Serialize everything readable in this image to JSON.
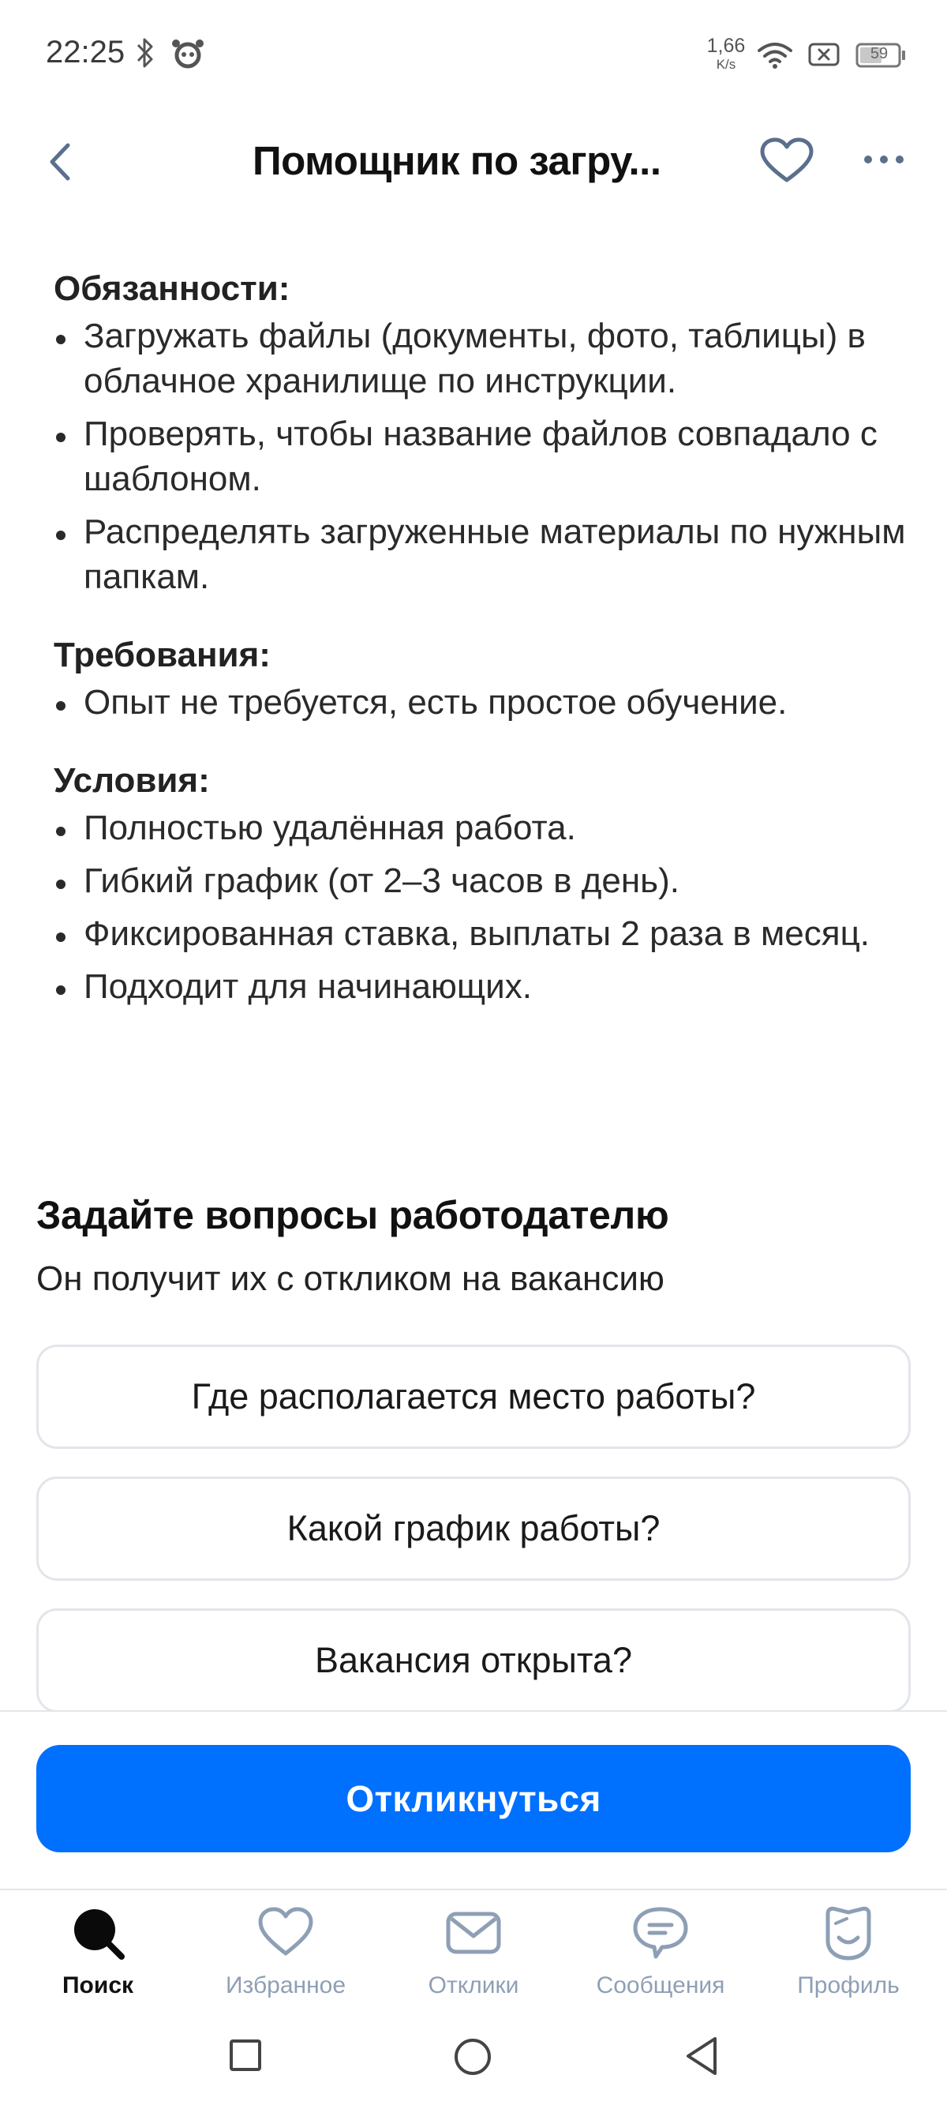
{
  "status_bar": {
    "time": "22:25",
    "net_speed_value": "1,66",
    "net_speed_unit": "K/s",
    "battery": "59"
  },
  "header": {
    "title": "Помощник по загру..."
  },
  "description": {
    "duties_title": "Обязанности:",
    "duties": [
      "Загружать файлы (документы, фото, таблицы) в облачное хранилище по инструкции.",
      "Проверять, чтобы название файлов совпадало с шаблоном.",
      "Распределять загруженные материалы по нужным папкам."
    ],
    "requirements_title": "Требования:",
    "requirements": [
      "Опыт не требуется, есть простое обучение."
    ],
    "conditions_title": "Условия:",
    "conditions": [
      "Полностью удалённая работа.",
      "Гибкий график (от 2–3 часов в день).",
      "Фиксированная ставка, выплаты 2 раза в месяц.",
      "Подходит для начинающих."
    ]
  },
  "questions": {
    "title": "Задайте вопросы работодателю",
    "subtitle": "Он получит их с откликом на вакансию",
    "items": [
      "Где располагается место работы?",
      "Какой график работы?",
      "Вакансия открыта?"
    ]
  },
  "apply_button": "Откликнуться",
  "bottom_nav": {
    "items": [
      {
        "label": "Поиск",
        "icon": "search-icon",
        "active": true
      },
      {
        "label": "Избранное",
        "icon": "heart-icon",
        "active": false
      },
      {
        "label": "Отклики",
        "icon": "envelope-icon",
        "active": false
      },
      {
        "label": "Сообщения",
        "icon": "chat-icon",
        "active": false
      },
      {
        "label": "Профиль",
        "icon": "profile-icon",
        "active": false
      }
    ]
  },
  "colors": {
    "accent": "#0070ff",
    "nav_inactive": "#8e9fb5",
    "text": "#1a1a1a"
  }
}
